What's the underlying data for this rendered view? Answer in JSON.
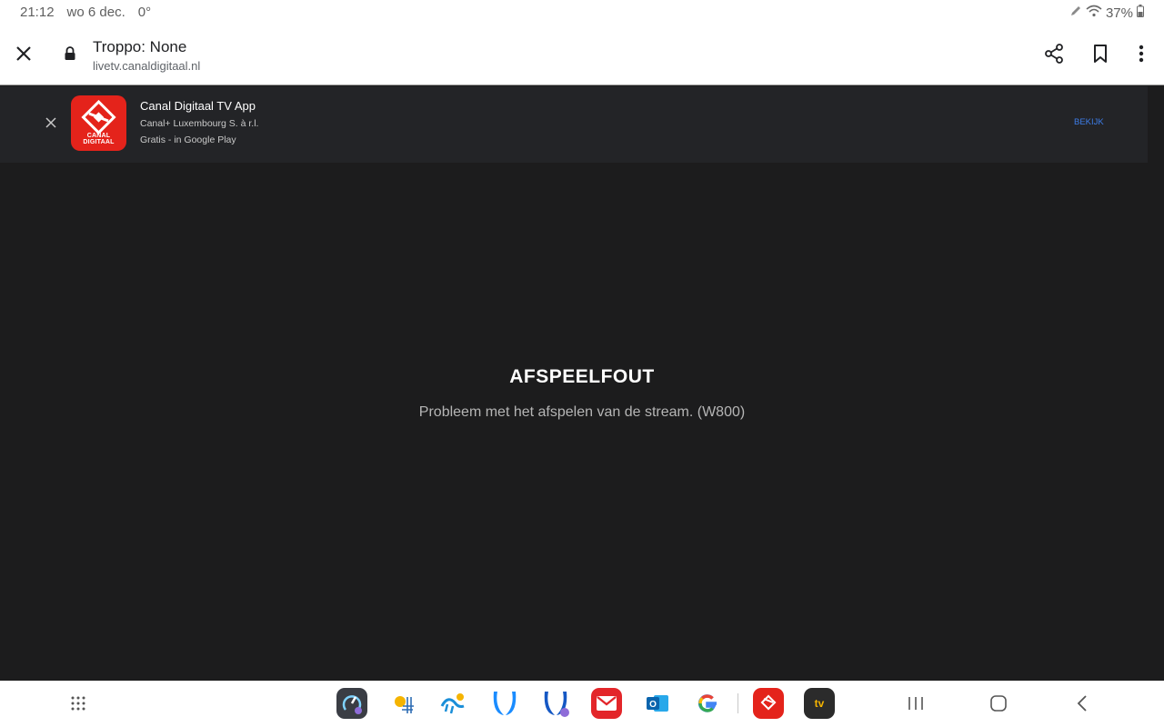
{
  "status_bar": {
    "time": "21:12",
    "date": "wo 6 dec.",
    "temperature": "0°",
    "battery": "37%"
  },
  "toolbar": {
    "title": "Troppo: None",
    "url": "livetv.canaldigitaal.nl",
    "close_icon": "close-icon",
    "lock_icon": "lock-icon",
    "share_icon": "share-icon",
    "bookmark_icon": "bookmark-icon",
    "menu_icon": "more-vert-icon"
  },
  "app_banner": {
    "app_name": "Canal Digitaal TV App",
    "developer": "Canal+ Luxembourg S. à r.l.",
    "price_store": "Gratis - in Google Play",
    "icon_label": "CANAL DIGITAAL",
    "action_label": "BEKIJK",
    "accent": "#3d7de8",
    "icon_color": "#e4231b"
  },
  "player": {
    "error_title": "AFSPEELFOUT",
    "error_message": "Probleem met het afspelen van de stream. (W800)"
  },
  "dock": {
    "apps": [
      {
        "name": "app-drawer-icon"
      },
      {
        "name": "speedtest-app-icon"
      },
      {
        "name": "weather-app-icon"
      },
      {
        "name": "buienradar-app-icon"
      },
      {
        "name": "bluesky-app-icon"
      },
      {
        "name": "bluesky-secure-app-icon"
      },
      {
        "name": "mail-app-icon"
      },
      {
        "name": "outlook-app-icon"
      },
      {
        "name": "google-app-icon"
      },
      {
        "name": "canal-digitaal-app-icon"
      },
      {
        "name": "tv-app-icon"
      }
    ],
    "outlook_letter": "O",
    "google_letter": "G",
    "tv_label": "tv"
  }
}
